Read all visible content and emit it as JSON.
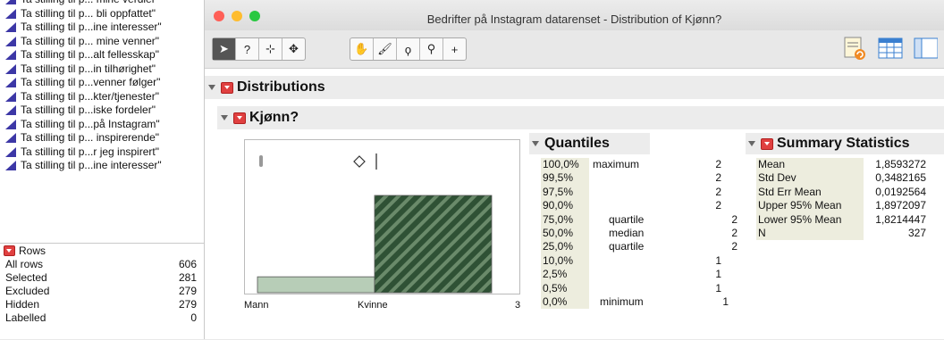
{
  "columns_panel": {
    "items": [
      "Ta stilling til p... mine verdier\"",
      "Ta stilling til p... bli oppfattet\"",
      "Ta stilling til p...ine interesser\"",
      "Ta stilling til p... mine venner\"",
      "Ta stilling til p...alt fellesskap\"",
      "Ta stilling til p...in tilhørighet\"",
      "Ta stilling til p...venner følger\"",
      "Ta stilling til p...kter/tjenester\"",
      "Ta stilling til p...iske fordeler\"",
      "Ta stilling til p...på Instagram\"",
      "Ta stilling til p... inspirerende\"",
      "Ta stilling til p...r jeg inspirert\"",
      "Ta stilling til p...ine interesser\""
    ],
    "icon": "continuous-column-icon"
  },
  "rows_panel": {
    "title": "Rows",
    "rows": [
      {
        "label": "All rows",
        "value": "606"
      },
      {
        "label": "Selected",
        "value": "281"
      },
      {
        "label": "Excluded",
        "value": "279"
      },
      {
        "label": "Hidden",
        "value": "279"
      },
      {
        "label": "Labelled",
        "value": "0"
      }
    ]
  },
  "window": {
    "title": "Bedrifter på Instagram datarenset - Distribution of Kjønn?",
    "traffic_colors": [
      "#ff5f57",
      "#febc2e",
      "#28c840"
    ]
  },
  "toolbar": {
    "group1": [
      "arrow-tool-icon",
      "help-tool-icon",
      "selection-tool-icon",
      "move-tool-icon"
    ],
    "group1_glyphs": [
      "➤",
      "?",
      "⊹",
      "✥"
    ],
    "group2": [
      "grabber-tool-icon",
      "brush-tool-icon",
      "lasso-tool-icon",
      "magnifier-tool-icon",
      "crosshair-tool-icon"
    ],
    "group2_glyphs": [
      "✋",
      "🖌",
      "ϙ",
      "⚲",
      "+"
    ]
  },
  "report": {
    "distributions_title": "Distributions",
    "variable_title": "Kjønn?"
  },
  "chart_data": {
    "type": "bar",
    "categories": [
      "Mann",
      "Kvinne"
    ],
    "values": [
      46,
      281
    ],
    "x_tick_labels": [
      "Mann",
      "Kvinne",
      "3"
    ],
    "selected_category": "Kvinne",
    "colors": {
      "bar": "#b7cdb7",
      "selected": "#2f5135",
      "stripe": "#6a8a6a"
    }
  },
  "quantiles": {
    "title": "Quantiles",
    "rows": [
      {
        "pct": "100,0%",
        "label": "maximum",
        "value": "2"
      },
      {
        "pct": "99,5%",
        "label": "",
        "value": "2"
      },
      {
        "pct": "97,5%",
        "label": "",
        "value": "2"
      },
      {
        "pct": "90,0%",
        "label": "",
        "value": "2"
      },
      {
        "pct": "75,0%",
        "label": "quartile",
        "value": "2"
      },
      {
        "pct": "50,0%",
        "label": "median",
        "value": "2"
      },
      {
        "pct": "25,0%",
        "label": "quartile",
        "value": "2"
      },
      {
        "pct": "10,0%",
        "label": "",
        "value": "1"
      },
      {
        "pct": "2,5%",
        "label": "",
        "value": "1"
      },
      {
        "pct": "0,5%",
        "label": "",
        "value": "1"
      },
      {
        "pct": "0,0%",
        "label": "minimum",
        "value": "1"
      }
    ]
  },
  "summary": {
    "title": "Summary Statistics",
    "rows": [
      {
        "label": "Mean",
        "value": "1,8593272"
      },
      {
        "label": "Std Dev",
        "value": "0,3482165"
      },
      {
        "label": "Std Err Mean",
        "value": "0,0192564"
      },
      {
        "label": "Upper 95% Mean",
        "value": "1,8972097"
      },
      {
        "label": "Lower 95% Mean",
        "value": "1,8214447"
      },
      {
        "label": "N",
        "value": "327"
      }
    ]
  }
}
